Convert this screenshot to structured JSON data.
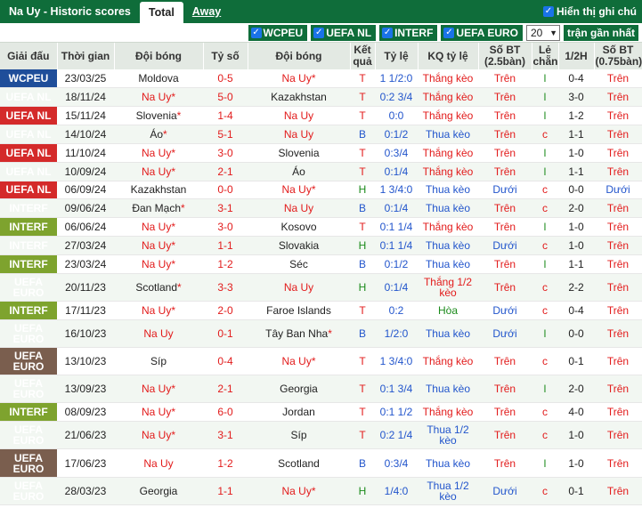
{
  "header": {
    "title": "Na Uy - Historic scores",
    "tabs": [
      {
        "label": "Total",
        "active": true
      },
      {
        "label": "Away",
        "active": false
      }
    ],
    "show_notes_label": "Hiển thị ghi chú"
  },
  "filters": {
    "items": [
      "WCPEU",
      "UEFA NL",
      "INTERF",
      "UEFA EURO"
    ],
    "count_value": "20",
    "recent_label": "trận gần nhất"
  },
  "columns": [
    "Giải đấu",
    "Thời gian",
    "Đội bóng",
    "Tỷ số",
    "Đội bóng",
    "Kết quả",
    "Tỷ lệ",
    "KQ tỷ lệ",
    "Số BT (2.5bàn)",
    "Lẻ chẵn",
    "1/2H",
    "Số BT (0.75bàn)"
  ],
  "rows": [
    {
      "league": "WCPEU",
      "lg": "wcpeu",
      "date": "23/03/25",
      "home": "Moldova",
      "home_star": "",
      "score": "0-5",
      "away": "Na Uy",
      "away_star": "*",
      "res": "T",
      "odds": "1 1/2:0",
      "kq": "Thắng kèo",
      "ou": "Trên",
      "oe": "l",
      "ht": "0-4",
      "ou75": "Trên",
      "hl": "away"
    },
    {
      "league": "UEFA NL",
      "lg": "nl",
      "date": "18/11/24",
      "home": "Na Uy",
      "home_star": "*",
      "score": "5-0",
      "away": "Kazakhstan",
      "away_star": "",
      "res": "T",
      "odds": "0:2 3/4",
      "kq": "Thắng kèo",
      "ou": "Trên",
      "oe": "l",
      "ht": "3-0",
      "ou75": "Trên",
      "hl": "home"
    },
    {
      "league": "UEFA NL",
      "lg": "nl",
      "date": "15/11/24",
      "home": "Slovenia",
      "home_star": "*",
      "score": "1-4",
      "away": "Na Uy",
      "away_star": "",
      "res": "T",
      "odds": "0:0",
      "kq": "Thắng kèo",
      "ou": "Trên",
      "oe": "l",
      "ht": "1-2",
      "ou75": "Trên",
      "hl": "away"
    },
    {
      "league": "UEFA NL",
      "lg": "nl",
      "date": "14/10/24",
      "home": "Áo",
      "home_star": "*",
      "score": "5-1",
      "away": "Na Uy",
      "away_star": "",
      "res": "B",
      "odds": "0:1/2",
      "kq": "Thua kèo",
      "ou": "Trên",
      "oe": "c",
      "ht": "1-1",
      "ou75": "Trên",
      "hl": "away"
    },
    {
      "league": "UEFA NL",
      "lg": "nl",
      "date": "11/10/24",
      "home": "Na Uy",
      "home_star": "*",
      "score": "3-0",
      "away": "Slovenia",
      "away_star": "",
      "res": "T",
      "odds": "0:3/4",
      "kq": "Thắng kèo",
      "ou": "Trên",
      "oe": "l",
      "ht": "1-0",
      "ou75": "Trên",
      "hl": "home"
    },
    {
      "league": "UEFA NL",
      "lg": "nl",
      "date": "10/09/24",
      "home": "Na Uy",
      "home_star": "*",
      "score": "2-1",
      "away": "Áo",
      "away_star": "",
      "res": "T",
      "odds": "0:1/4",
      "kq": "Thắng kèo",
      "ou": "Trên",
      "oe": "l",
      "ht": "1-1",
      "ou75": "Trên",
      "hl": "home"
    },
    {
      "league": "UEFA NL",
      "lg": "nl",
      "date": "06/09/24",
      "home": "Kazakhstan",
      "home_star": "",
      "score": "0-0",
      "away": "Na Uy",
      "away_star": "*",
      "res": "H",
      "odds": "1 3/4:0",
      "kq": "Thua kèo",
      "ou": "Dưới",
      "oe": "c",
      "ht": "0-0",
      "ou75": "Dưới",
      "hl": "away"
    },
    {
      "league": "INTERF",
      "lg": "interf",
      "date": "09/06/24",
      "home": "Đan Mạch",
      "home_star": "*",
      "score": "3-1",
      "away": "Na Uy",
      "away_star": "",
      "res": "B",
      "odds": "0:1/4",
      "kq": "Thua kèo",
      "ou": "Trên",
      "oe": "c",
      "ht": "2-0",
      "ou75": "Trên",
      "hl": "away"
    },
    {
      "league": "INTERF",
      "lg": "interf",
      "date": "06/06/24",
      "home": "Na Uy",
      "home_star": "*",
      "score": "3-0",
      "away": "Kosovo",
      "away_star": "",
      "res": "T",
      "odds": "0:1 1/4",
      "kq": "Thắng kèo",
      "ou": "Trên",
      "oe": "l",
      "ht": "1-0",
      "ou75": "Trên",
      "hl": "home"
    },
    {
      "league": "INTERF",
      "lg": "interf",
      "date": "27/03/24",
      "home": "Na Uy",
      "home_star": "*",
      "score": "1-1",
      "away": "Slovakia",
      "away_star": "",
      "res": "H",
      "odds": "0:1 1/4",
      "kq": "Thua kèo",
      "ou": "Dưới",
      "oe": "c",
      "ht": "1-0",
      "ou75": "Trên",
      "hl": "home"
    },
    {
      "league": "INTERF",
      "lg": "interf",
      "date": "23/03/24",
      "home": "Na Uy",
      "home_star": "*",
      "score": "1-2",
      "away": "Séc",
      "away_star": "",
      "res": "B",
      "odds": "0:1/2",
      "kq": "Thua kèo",
      "ou": "Trên",
      "oe": "l",
      "ht": "1-1",
      "ou75": "Trên",
      "hl": "home"
    },
    {
      "league": "UEFA EURO",
      "lg": "euro",
      "date": "20/11/23",
      "home": "Scotland",
      "home_star": "*",
      "score": "3-3",
      "away": "Na Uy",
      "away_star": "",
      "res": "H",
      "odds": "0:1/4",
      "kq": "Thắng 1/2 kèo",
      "ou": "Trên",
      "oe": "c",
      "ht": "2-2",
      "ou75": "Trên",
      "hl": "away",
      "tall": true
    },
    {
      "league": "INTERF",
      "lg": "interf",
      "date": "17/11/23",
      "home": "Na Uy",
      "home_star": "*",
      "score": "2-0",
      "away": "Faroe Islands",
      "away_star": "",
      "res": "T",
      "odds": "0:2",
      "kq": "Hòa",
      "ou": "Dưới",
      "oe": "c",
      "ht": "0-4",
      "ou75": "Trên",
      "hl": "home"
    },
    {
      "league": "UEFA EURO",
      "lg": "euro",
      "date": "16/10/23",
      "home": "Na Uy",
      "home_star": "",
      "score": "0-1",
      "away": "Tây Ban Nha",
      "away_star": "*",
      "res": "B",
      "odds": "1/2:0",
      "kq": "Thua kèo",
      "ou": "Dưới",
      "oe": "l",
      "ht": "0-0",
      "ou75": "Trên",
      "hl": "home",
      "tall": true
    },
    {
      "league": "UEFA EURO",
      "lg": "euro",
      "date": "13/10/23",
      "home": "Síp",
      "home_star": "",
      "score": "0-4",
      "away": "Na Uy",
      "away_star": "*",
      "res": "T",
      "odds": "1 3/4:0",
      "kq": "Thắng kèo",
      "ou": "Trên",
      "oe": "c",
      "ht": "0-1",
      "ou75": "Trên",
      "hl": "away",
      "tall": true
    },
    {
      "league": "UEFA EURO",
      "lg": "euro",
      "date": "13/09/23",
      "home": "Na Uy",
      "home_star": "*",
      "score": "2-1",
      "away": "Georgia",
      "away_star": "",
      "res": "T",
      "odds": "0:1 3/4",
      "kq": "Thua kèo",
      "ou": "Trên",
      "oe": "l",
      "ht": "2-0",
      "ou75": "Trên",
      "hl": "home",
      "tall": true
    },
    {
      "league": "INTERF",
      "lg": "interf",
      "date": "08/09/23",
      "home": "Na Uy",
      "home_star": "*",
      "score": "6-0",
      "away": "Jordan",
      "away_star": "",
      "res": "T",
      "odds": "0:1 1/2",
      "kq": "Thắng kèo",
      "ou": "Trên",
      "oe": "c",
      "ht": "4-0",
      "ou75": "Trên",
      "hl": "home"
    },
    {
      "league": "UEFA EURO",
      "lg": "euro",
      "date": "21/06/23",
      "home": "Na Uy",
      "home_star": "*",
      "score": "3-1",
      "away": "Síp",
      "away_star": "",
      "res": "T",
      "odds": "0:2 1/4",
      "kq": "Thua 1/2 kèo",
      "ou": "Trên",
      "oe": "c",
      "ht": "1-0",
      "ou75": "Trên",
      "hl": "home",
      "tall": true
    },
    {
      "league": "UEFA EURO",
      "lg": "euro",
      "date": "17/06/23",
      "home": "Na Uy",
      "home_star": "",
      "score": "1-2",
      "away": "Scotland",
      "away_star": "",
      "res": "B",
      "odds": "0:3/4",
      "kq": "Thua kèo",
      "ou": "Trên",
      "oe": "l",
      "ht": "1-0",
      "ou75": "Trên",
      "hl": "home",
      "tall": true
    },
    {
      "league": "UEFA EURO",
      "lg": "euro",
      "date": "28/03/23",
      "home": "Georgia",
      "home_star": "",
      "score": "1-1",
      "away": "Na Uy",
      "away_star": "*",
      "res": "H",
      "odds": "1/4:0",
      "kq": "Thua 1/2 kèo",
      "ou": "Dưới",
      "oe": "c",
      "ht": "0-1",
      "ou75": "Trên",
      "hl": "away",
      "tall": true
    }
  ]
}
